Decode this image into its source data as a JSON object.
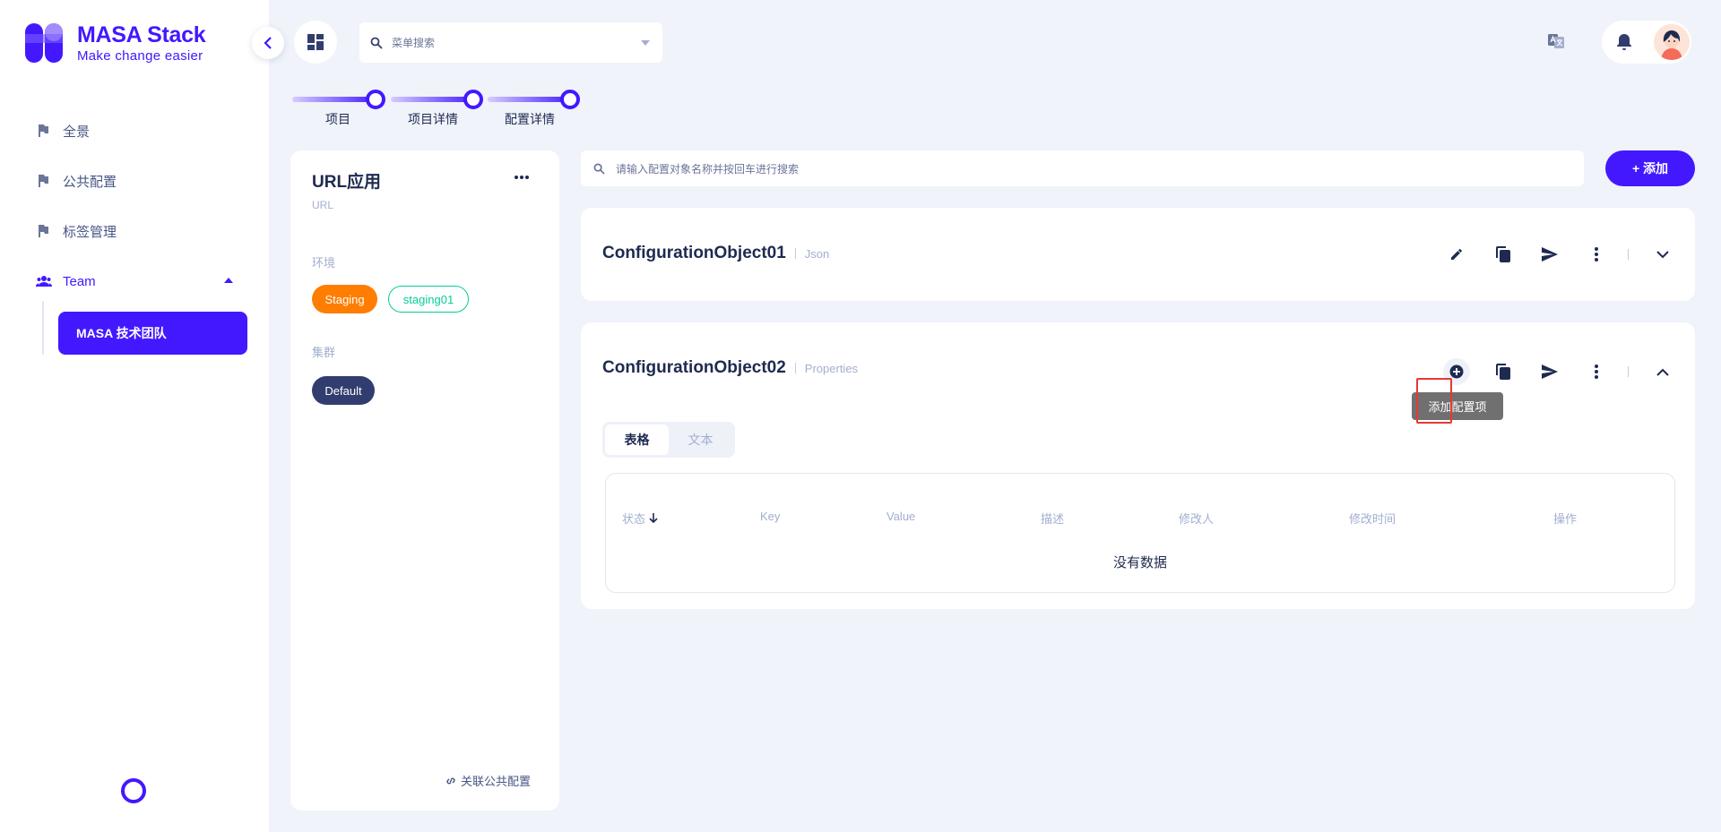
{
  "brand": {
    "title": "MASA Stack",
    "tagline": "Make change easier",
    "color": "#4318ff"
  },
  "header": {
    "menu_search_placeholder": "菜单搜索",
    "icons": [
      "dashboard-icon",
      "search-icon",
      "dropdown-arrow-icon",
      "translate-icon",
      "bell-icon"
    ]
  },
  "sidebar": {
    "items": [
      {
        "label": "全景",
        "icon": "flag-icon"
      },
      {
        "label": "公共配置",
        "icon": "flag-icon"
      },
      {
        "label": "标签管理",
        "icon": "flag-icon"
      },
      {
        "label": "Team",
        "icon": "team-icon"
      }
    ],
    "team_active": "MASA 技术团队"
  },
  "steps": [
    "项目",
    "项目详情",
    "配置详情"
  ],
  "app": {
    "title": "URL应用",
    "subtitle": "URL",
    "env_label": "环境",
    "envs": [
      "Staging",
      "staging01"
    ],
    "cluster_label": "集群",
    "cluster": "Default",
    "link_public": "关联公共配置"
  },
  "main": {
    "search_placeholder": "请输入配置对象名称并按回车进行搜索",
    "add_label": "+ 添加",
    "configs": [
      {
        "name": "ConfigurationObject01",
        "format": "Json"
      },
      {
        "name": "ConfigurationObject02",
        "format": "Properties"
      }
    ],
    "tabs": [
      "表格",
      "文本"
    ],
    "columns": [
      "状态",
      "Key",
      "Value",
      "描述",
      "修改人",
      "修改时间",
      "操作"
    ],
    "no_data": "没有数据",
    "tooltip": "添加配置项"
  },
  "colors": {
    "primary": "#4318ff",
    "staging": "#ff7d00",
    "staging01": "#05cd99",
    "default_chip": "#323d6f",
    "highlight": "#e53935"
  }
}
